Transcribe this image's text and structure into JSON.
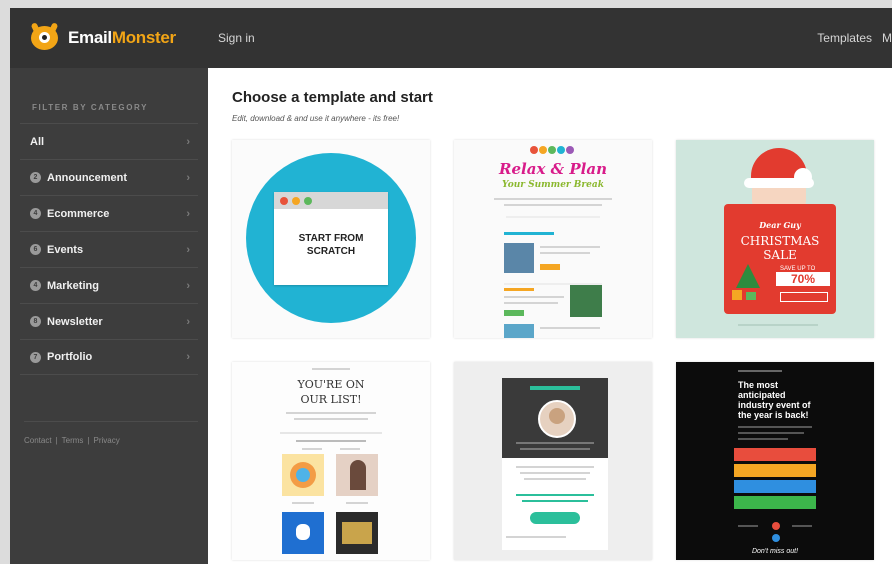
{
  "header": {
    "logo_word1": "Email",
    "logo_word2": "Monster",
    "signin": "Sign in",
    "nav": [
      "Templates",
      "M"
    ]
  },
  "sidebar": {
    "filter_title": "FILTER BY CATEGORY",
    "categories": [
      {
        "label": "All",
        "num": ""
      },
      {
        "label": "Announcement",
        "num": "2"
      },
      {
        "label": "Ecommerce",
        "num": "4"
      },
      {
        "label": "Events",
        "num": "6"
      },
      {
        "label": "Marketing",
        "num": "4"
      },
      {
        "label": "Newsletter",
        "num": "8"
      },
      {
        "label": "Portfolio",
        "num": "7"
      }
    ],
    "footer_links": [
      "Contact",
      "|",
      "Terms",
      "|",
      "Privacy"
    ]
  },
  "main": {
    "headline": "Choose a template and start",
    "subhead": "Edit, download & and use it anywhere - its free!"
  },
  "cards": {
    "scratch": {
      "text": "START FROM\nSCRATCH"
    },
    "relax": {
      "title": "Relax & Plan",
      "subtitle": "Your Summer Break"
    },
    "christmas": {
      "signature": "Dear Guy",
      "title": "CHRISTMAS",
      "title2": "SALE",
      "save_text": "SAVE UP TO",
      "percent": "70%"
    },
    "list": {
      "title": "YOU'RE ON",
      "title2": "OUR LIST!"
    },
    "event": {
      "title": "The most",
      "title2": "anticipated",
      "title3": "industry event of",
      "title4": "the year is back!",
      "footer": "Don't miss out!"
    }
  },
  "colors": {
    "topbar": "#333333",
    "sidebar": "#3d3d3d",
    "accent": "#f2a516",
    "scratch_circle": "#21b3d3",
    "dot_red": "#e8533a",
    "dot_orange": "#f5a623",
    "dot_green": "#5cb85c"
  }
}
